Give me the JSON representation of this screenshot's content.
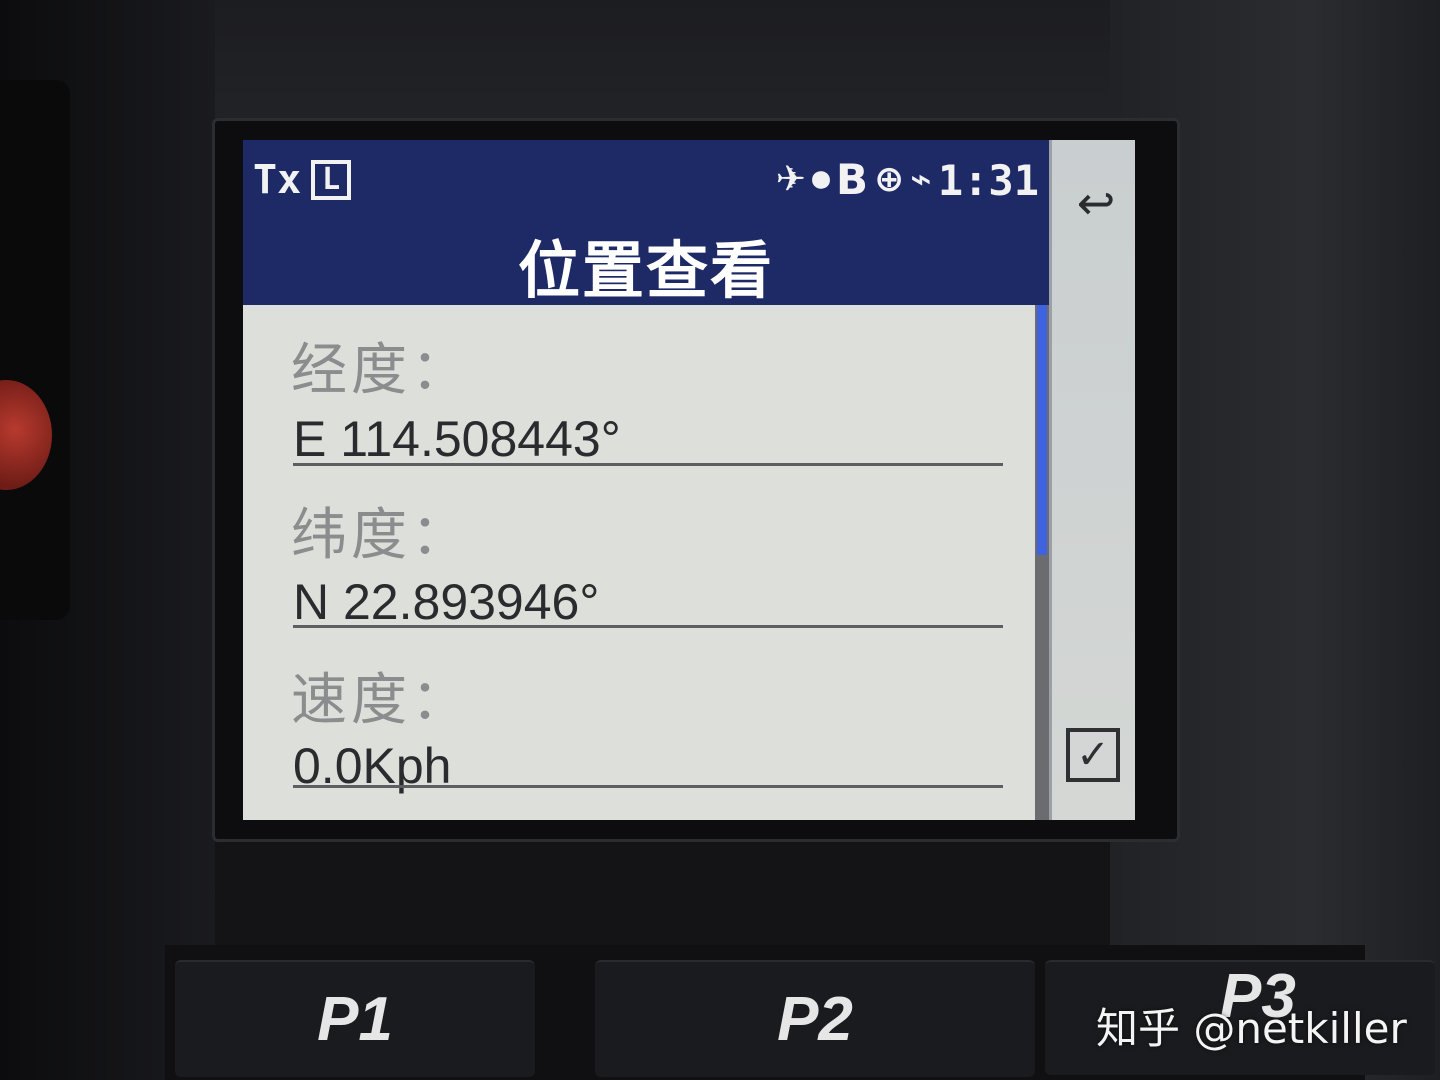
{
  "status_bar": {
    "tx_label": "Tx",
    "l_label": "L",
    "bt_label": "B",
    "time": "1:31"
  },
  "title": "位置查看",
  "fields": [
    {
      "label": "经度：",
      "value": "E 114.508443°"
    },
    {
      "label": "纬度：",
      "value": "N 22.893946°"
    },
    {
      "label": "速度：",
      "value": "0.0Kph"
    }
  ],
  "softkeys": {
    "back_icon": "↩",
    "ok_icon": "✓"
  },
  "physical_keys": [
    "P1",
    "P2",
    "P3"
  ],
  "watermark": "知乎 @netkiller",
  "colors": {
    "header": "#1e2a66",
    "screen_bg": "#dcdfda",
    "scroll_thumb": "#3f63e0"
  }
}
